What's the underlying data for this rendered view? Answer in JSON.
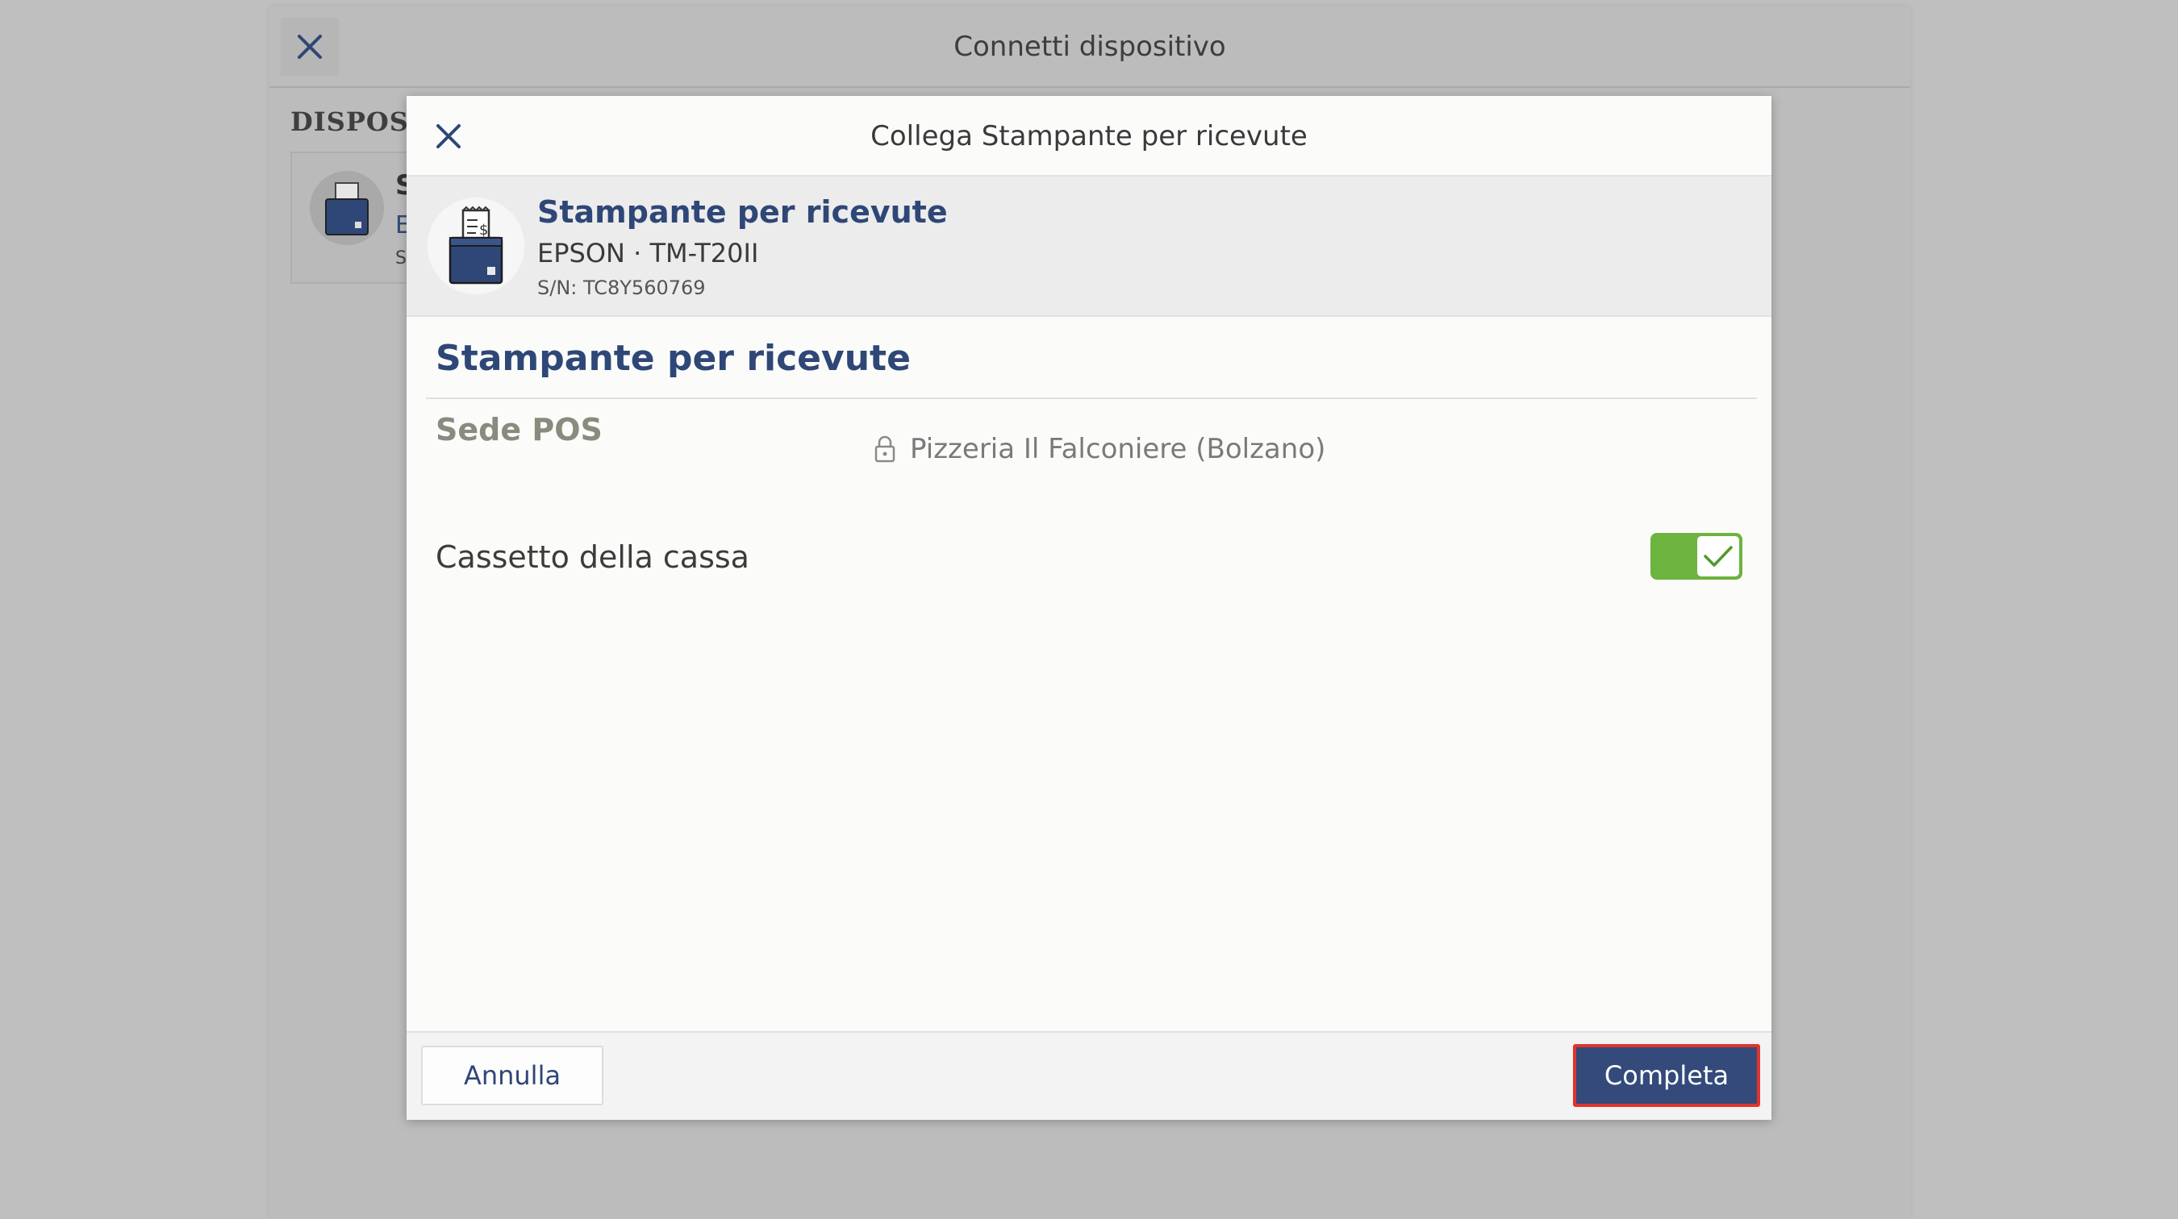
{
  "background_window": {
    "title": "Connetti dispositivo",
    "section_label": "DISPOSIT",
    "card": {
      "name_fragment": "S",
      "brand_fragment": "E",
      "sn_fragment": "S,"
    }
  },
  "modal": {
    "title": "Collega Stampante per ricevute",
    "device": {
      "name": "Stampante per ricevute",
      "model": "EPSON · TM-T20II",
      "serial": "S/N: TC8Y560769"
    },
    "section_title": "Stampante per ricevute",
    "sede": {
      "label": "Sede POS",
      "value": "Pizzeria Il Falconiere (Bolzano)"
    },
    "cassetto": {
      "label": "Cassetto della cassa",
      "enabled": true
    },
    "footer": {
      "cancel_label": "Annulla",
      "complete_label": "Completa"
    }
  },
  "colors": {
    "accent": "#2f4777",
    "toggle_on": "#6db33f",
    "primary_button": "#334a7a",
    "focus_outline": "#e0352b"
  },
  "icons": {
    "close": "close-icon",
    "printer": "receipt-printer-icon",
    "lock": "lock-icon",
    "check": "check-icon"
  }
}
